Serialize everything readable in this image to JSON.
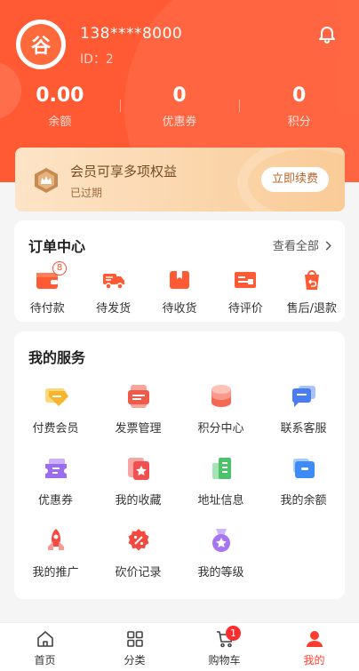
{
  "profile": {
    "phone": "138****8000",
    "id_text": "ID：2",
    "avatar_char": "谷"
  },
  "stats": [
    {
      "value": "0.00",
      "label": "余额"
    },
    {
      "value": "0",
      "label": "优惠券"
    },
    {
      "value": "0",
      "label": "积分"
    }
  ],
  "vip": {
    "title": "会员可享多项权益",
    "status": "已过期",
    "button": "立即续费"
  },
  "orders": {
    "title": "订单中心",
    "view_all": "查看全部",
    "items": [
      {
        "label": "待付款",
        "icon": "wallet-icon",
        "badge": "8"
      },
      {
        "label": "待发货",
        "icon": "truck-icon"
      },
      {
        "label": "待收货",
        "icon": "package-icon"
      },
      {
        "label": "待评价",
        "icon": "comment-icon"
      },
      {
        "label": "售后/退款",
        "icon": "return-icon"
      }
    ]
  },
  "services": {
    "title": "我的服务",
    "items": [
      {
        "label": "付费会员",
        "icon": "diamond-icon",
        "color": "#f7b52b"
      },
      {
        "label": "发票管理",
        "icon": "invoice-icon",
        "color": "#f05a4a"
      },
      {
        "label": "积分中心",
        "icon": "coins-icon",
        "color": "#f26a55"
      },
      {
        "label": "联系客服",
        "icon": "chat-icon",
        "color": "#4a7cf2"
      },
      {
        "label": "优惠券",
        "icon": "ticket-icon",
        "color": "#9b6cf0"
      },
      {
        "label": "我的收藏",
        "icon": "star-card-icon",
        "color": "#f0504f"
      },
      {
        "label": "地址信息",
        "icon": "building-icon",
        "color": "#4cc26a"
      },
      {
        "label": "我的余额",
        "icon": "wallet-blue-icon",
        "color": "#3d8cf5"
      },
      {
        "label": "我的推广",
        "icon": "rocket-icon",
        "color": "#f3493f"
      },
      {
        "label": "砍价记录",
        "icon": "discount-icon",
        "color": "#f3493f"
      },
      {
        "label": "我的等级",
        "icon": "medal-icon",
        "color": "#a774f3"
      }
    ]
  },
  "tabbar": [
    {
      "label": "首页",
      "icon": "home-icon"
    },
    {
      "label": "分类",
      "icon": "grid-icon"
    },
    {
      "label": "购物车",
      "icon": "cart-icon",
      "badge": "1"
    },
    {
      "label": "我的",
      "icon": "user-icon",
      "active": true
    }
  ],
  "colors": {
    "brand": "#ff5a33",
    "accent": "#ff3d2e",
    "vip_text": "#7a4b22"
  }
}
